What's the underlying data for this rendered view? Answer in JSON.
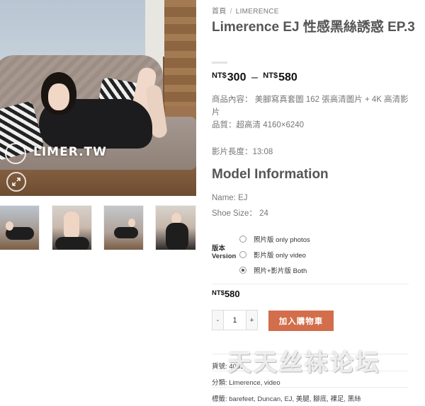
{
  "breadcrumb": {
    "home": "首頁",
    "separator": "/",
    "category": "LIMERENCE"
  },
  "product": {
    "title": "Limerence EJ 性感黑絲誘惑 EP.3",
    "price_currency": "NT$",
    "price_min": "300",
    "price_dash": "–",
    "price_max": "580",
    "content_line": "商品內容： 美腳寫真套圖 162 張高清圖片 + 4K 高清影片",
    "quality_line": "品質：超高清 4160×6240",
    "duration_line": "影片長度：13:08"
  },
  "model": {
    "heading": "Model Information",
    "name_line": "Name: EJ",
    "shoe_line": "Shoe Size： 24"
  },
  "version": {
    "label": "版本 Version",
    "options": [
      {
        "label": "照片版 only photos",
        "checked": false
      },
      {
        "label": "影片版 only video",
        "checked": false
      },
      {
        "label": "照片+影片版 Both",
        "checked": true
      }
    ]
  },
  "selected_price": {
    "currency": "NT$",
    "amount": "580"
  },
  "quantity": {
    "minus": "-",
    "value": "1",
    "plus": "+"
  },
  "add_to_cart": "加入購物車",
  "meta": {
    "sku": "貨號: 4061",
    "categories": "分類: Limerence, video",
    "tags": "標籤: barefeet, Duncan, EJ, 美腿, 腳底, 裸足, 黑絲"
  },
  "gallery": {
    "watermark": "LIMER.TW",
    "icons": [
      "zoom-icon"
    ]
  },
  "overlay_watermark": "天天丝袜论坛",
  "colors": {
    "accent": "#d26e4b",
    "text": "#555555",
    "price": "#111111"
  }
}
